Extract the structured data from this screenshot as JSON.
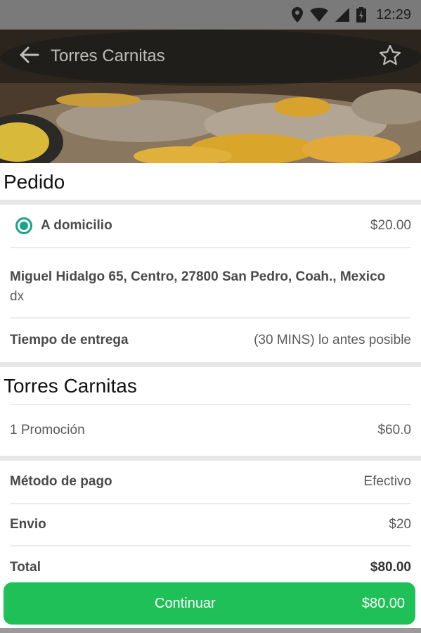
{
  "status_bar": {
    "time": "12:29"
  },
  "toolbar": {
    "title": "Torres Carnitas"
  },
  "order": {
    "title": "Pedido",
    "delivery_option": {
      "label": "A domicilio",
      "price": "$20.00",
      "selected": true
    },
    "address": "Miguel Hidalgo 65, Centro, 27800 San Pedro, Coah., Mexico",
    "address_note": "dx",
    "delivery_time_label": "Tiempo de entrega",
    "delivery_time_value": "(30 MINS) lo antes posible"
  },
  "restaurant": {
    "name": "Torres Carnitas",
    "items": [
      {
        "qty_name": "1  Promoción",
        "price": "$60.0"
      }
    ]
  },
  "summary": {
    "payment_label": "Método de pago",
    "payment_value": "Efectivo",
    "shipping_label": "Envio",
    "shipping_value": "$20",
    "total_label": "Total",
    "total_value": "$80.00"
  },
  "continue_button": {
    "label": "Continuar",
    "total": "$80.00"
  },
  "colors": {
    "accent": "#17a48a",
    "button": "#1fc057"
  }
}
